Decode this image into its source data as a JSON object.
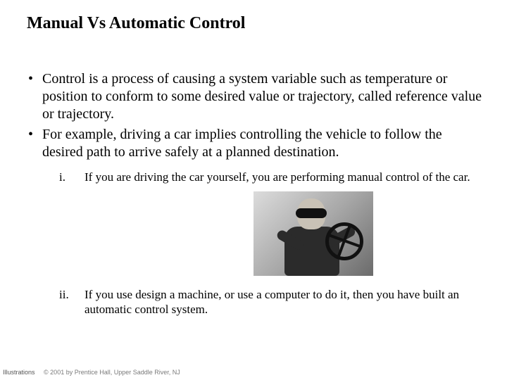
{
  "title": "Manual Vs Automatic Control",
  "bullets": [
    "Control is a process of causing a system variable such as temperature or position to conform to some desired value or trajectory, called reference value or trajectory.",
    "For example, driving a car implies controlling the vehicle to follow the desired path to arrive safely at a planned destination."
  ],
  "sub": {
    "markers": [
      "i.",
      "ii."
    ],
    "items": [
      "If you are driving the car yourself, you are performing manual control of the car.",
      "If you use design a machine, or use a computer to do it, then you have built an automatic control system."
    ]
  },
  "image": {
    "alt": "driver-with-steering-wheel"
  },
  "footer": {
    "lead": "Illustrations",
    "copyright": "© 2001 by Prentice Hall, Upper Saddle River, NJ"
  }
}
